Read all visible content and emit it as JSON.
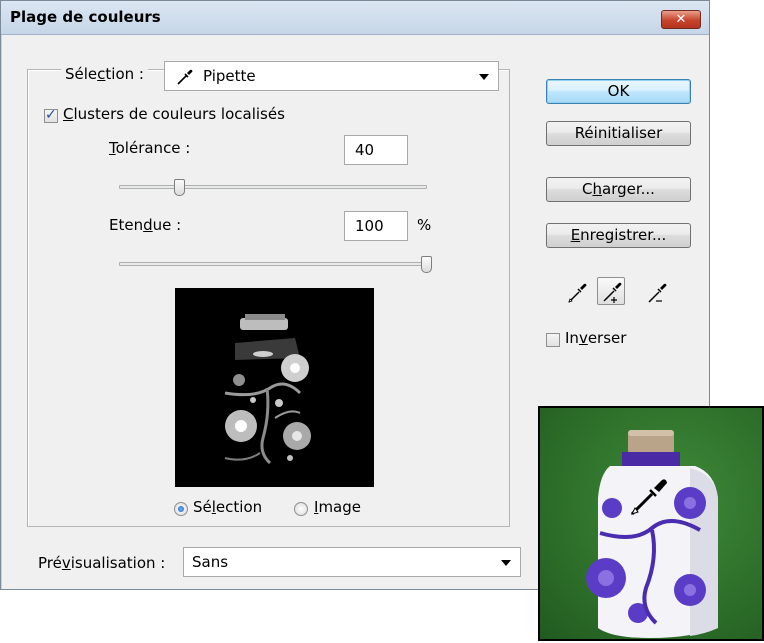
{
  "dialog": {
    "title": "Plage de couleurs",
    "close_label": "✕"
  },
  "selection": {
    "label_prefix": "Séle",
    "label_mnemonic": "c",
    "label_suffix": "tion :",
    "value": "Pipette"
  },
  "localized_clusters": {
    "label_mnemonic": "C",
    "label_suffix": "lusters de couleurs localisés",
    "checked": true
  },
  "tolerance": {
    "label_mnemonic": "T",
    "label_suffix": "olérance :",
    "value": "40",
    "slider_fraction": 0.3
  },
  "range": {
    "label_prefix": "Eten",
    "label_mnemonic": "d",
    "label_suffix": "ue :",
    "value": "100",
    "unit": "%",
    "slider_fraction": 1.0
  },
  "view_mode": {
    "selection_prefix": "Sé",
    "selection_mnemonic": "l",
    "selection_suffix": "ection",
    "image_mnemonic": "I",
    "image_suffix": "mage",
    "selected": "selection"
  },
  "preview": {
    "label_prefix": "Pré",
    "label_mnemonic": "v",
    "label_suffix": "isualisation :",
    "value": "Sans"
  },
  "buttons": {
    "ok": "OK",
    "reset": "Réinitialiser",
    "load_prefix": "C",
    "load_mnemonic": "h",
    "load_suffix": "arger...",
    "save_mnemonic": "E",
    "save_suffix": "nregistrer..."
  },
  "invert": {
    "label_prefix": "In",
    "label_mnemonic": "v",
    "label_suffix": "erser",
    "checked": false
  },
  "eyedroppers": [
    "eyedropper-icon",
    "eyedropper-plus-icon",
    "eyedropper-minus-icon"
  ],
  "colors": {
    "dialog_bg": "#f0f0f0",
    "photo_bg": "#2a6a27",
    "accent_blue": "#5a3fc0"
  }
}
